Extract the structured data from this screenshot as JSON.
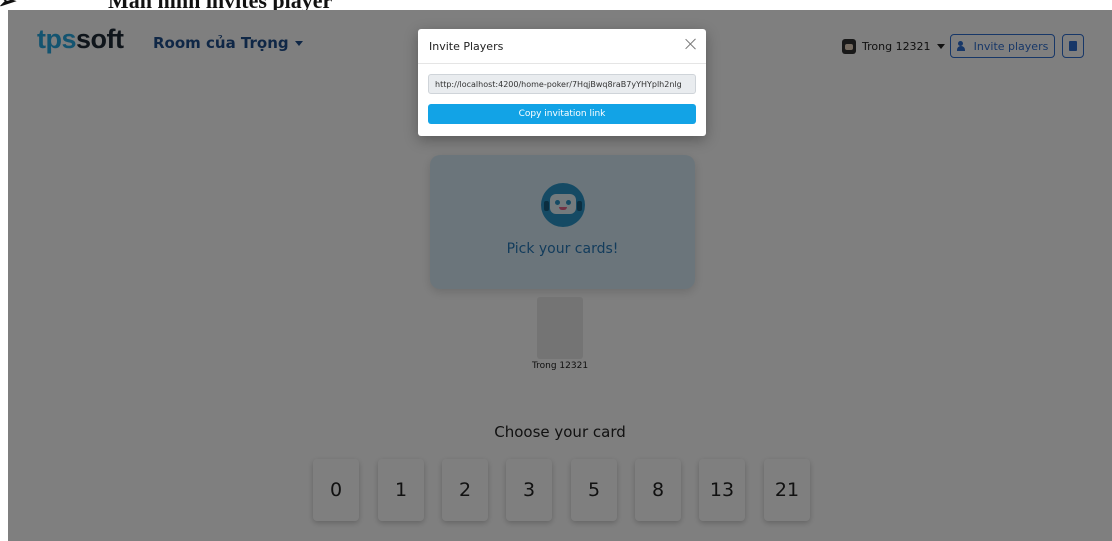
{
  "document": {
    "bullet": "➢",
    "heading": "Màn hình invites player"
  },
  "navbar": {
    "logo_part1": "tps",
    "logo_part2": "soft",
    "room_name": "Room của Trọng",
    "user_name": "Trong 12321",
    "invite_label": "Invite players"
  },
  "table": {
    "message": "Pick your cards!",
    "player_name": "Trong 12321"
  },
  "deck": {
    "label": "Choose your card",
    "cards": [
      "0",
      "1",
      "2",
      "3",
      "5",
      "8",
      "13",
      "21"
    ]
  },
  "modal": {
    "title": "Invite Players",
    "link": "http://localhost:4200/home-poker/7HqjBwq8raB7yYHYplh2nlg",
    "copy_label": "Copy invitation link"
  },
  "colors": {
    "brand": "#29a8e0",
    "primary": "#2f6fd0",
    "copy_button": "#12a3e6",
    "table": "#d6ebf7"
  }
}
